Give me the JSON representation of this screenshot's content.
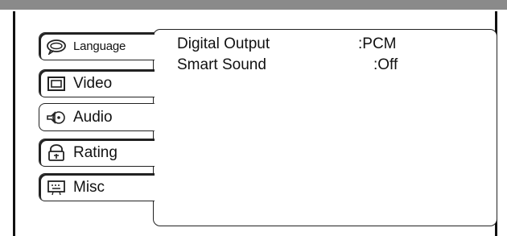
{
  "tabs": [
    {
      "label": "Language",
      "icon": "speech-bubble-icon"
    },
    {
      "label": "Video",
      "icon": "monitor-icon"
    },
    {
      "label": "Audio",
      "icon": "speaker-icon"
    },
    {
      "label": "Rating",
      "icon": "lock-icon"
    },
    {
      "label": "Misc",
      "icon": "keyboard-icon"
    }
  ],
  "active_tab": "Audio",
  "settings": [
    {
      "label": "Digital Output",
      "value": ":PCM"
    },
    {
      "label": "Smart Sound",
      "value": ":Off"
    }
  ],
  "colors": {
    "top_bar": "#8a8a8a",
    "border": "#222222"
  }
}
